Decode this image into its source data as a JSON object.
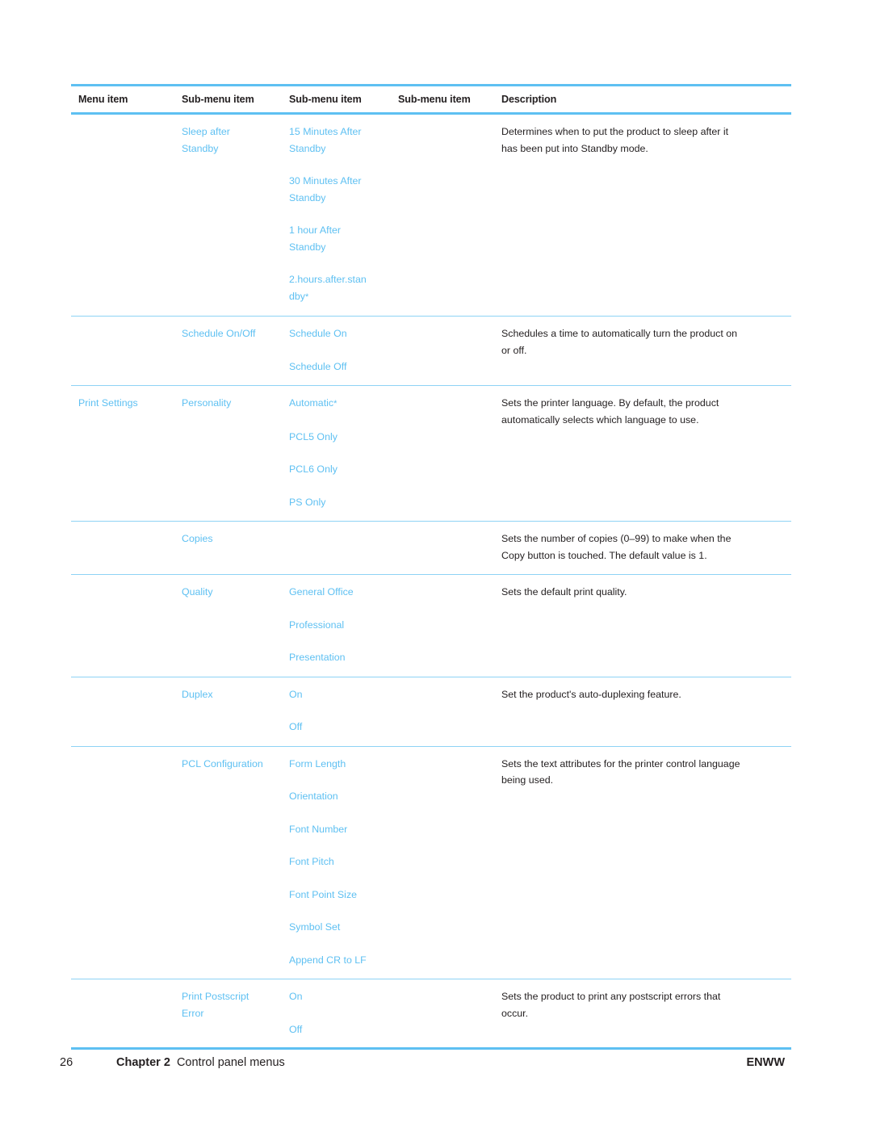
{
  "document": {
    "page_number": "26",
    "chapter_label": "Chapter 2",
    "chapter_title": "Control panel menus",
    "footer_right": "ENWW"
  },
  "theme": {
    "accent_blue": "#5ec0f2",
    "rule_blue": "#8ed3f5",
    "text_black": "#231f20"
  },
  "table": {
    "headers": [
      "Menu item",
      "Sub-menu item",
      "Sub-menu item",
      "Sub-menu item",
      "Description"
    ],
    "rows": [
      {
        "menu_item": [],
        "sub1": [
          "Sleep after",
          "Standby"
        ],
        "sub1_wrap": true,
        "sub2": [
          "15 Minutes After|Standby",
          "30 Minutes After|Standby",
          "1 hour After|Standby",
          "2.hours.after.stan|dby*"
        ],
        "sub3": [],
        "description": [
          "Determines when to put the product to sleep after it",
          "has been put into Standby mode."
        ]
      },
      {
        "menu_item": [],
        "sub1": [
          "Schedule On/Off"
        ],
        "sub2": [
          "Schedule On",
          "Schedule Off"
        ],
        "sub3": [],
        "description": [
          "Schedules a time to automatically turn the product on",
          "or off."
        ]
      },
      {
        "menu_item": [
          "Print Settings"
        ],
        "sub1": [
          "Personality"
        ],
        "sub2": [
          "Automatic*",
          "PCL5 Only",
          "PCL6 Only",
          "PS Only"
        ],
        "sub3": [],
        "description": [
          "Sets the printer language. By default, the product",
          "automatically selects which language to use."
        ]
      },
      {
        "menu_item": [],
        "sub1": [
          "Copies"
        ],
        "sub2": [],
        "sub3": [],
        "description": [
          "Sets the number of copies (0–99) to make when the",
          "Copy button is touched. The default value is 1."
        ]
      },
      {
        "menu_item": [],
        "sub1": [
          "Quality"
        ],
        "sub2": [
          "General Office",
          "Professional",
          "Presentation"
        ],
        "sub3": [],
        "description": [
          "Sets the default print quality."
        ]
      },
      {
        "menu_item": [],
        "sub1": [
          "Duplex"
        ],
        "sub2": [
          "On",
          "Off"
        ],
        "sub3": [],
        "description": [
          "Set the product's auto-duplexing feature."
        ]
      },
      {
        "menu_item": [],
        "sub1": [
          "PCL Configuration"
        ],
        "sub2": [
          "Form Length",
          "Orientation",
          "Font Number",
          "Font Pitch",
          "Font Point Size",
          "Symbol Set",
          "Append CR to LF"
        ],
        "sub3": [],
        "description": [
          "Sets the text attributes for the printer control language",
          "being used."
        ]
      },
      {
        "menu_item": [],
        "sub1": [
          "Print Postscript",
          "Error"
        ],
        "sub1_wrap": true,
        "sub2": [
          "On",
          "Off"
        ],
        "sub3": [],
        "description": [
          "Sets the product to print any postscript errors that",
          "occur."
        ]
      }
    ]
  }
}
